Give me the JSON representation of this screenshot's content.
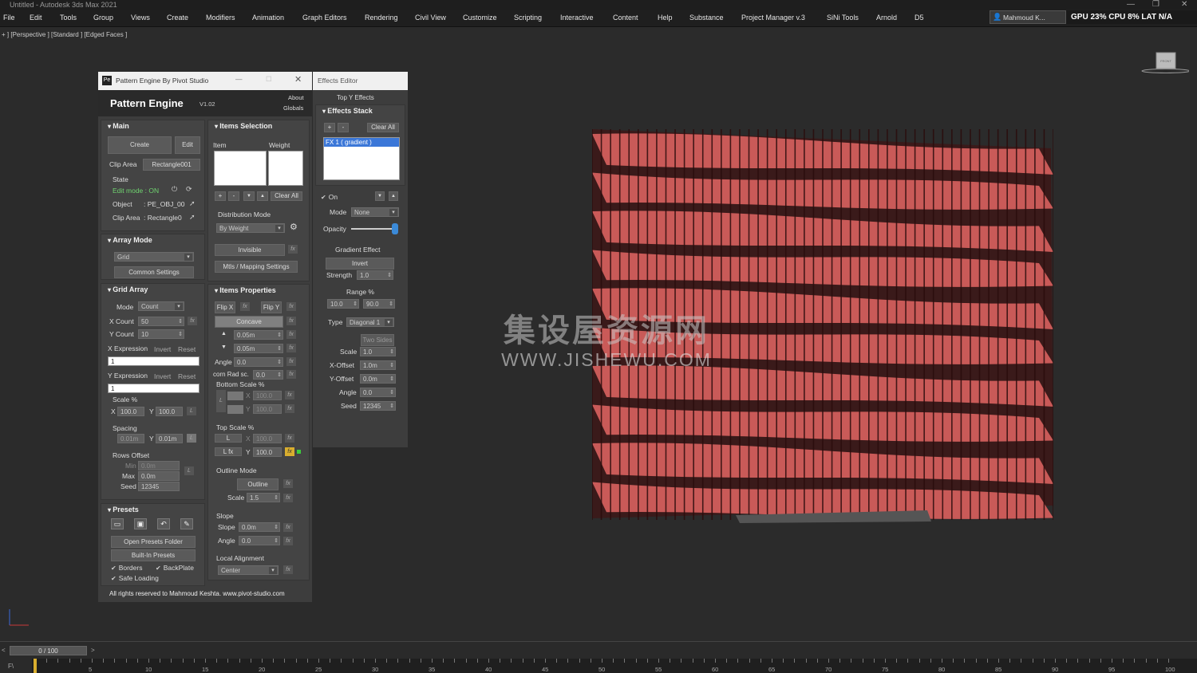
{
  "titlebar": {
    "title": "Untitled - Autodesk 3ds Max 2021",
    "controls": [
      "—",
      "❐",
      "✕"
    ]
  },
  "menu": [
    "File",
    "Edit",
    "Tools",
    "Group",
    "Views",
    "Create",
    "Modifiers",
    "Animation",
    "Graph Editors",
    "Rendering",
    "Civil View",
    "Customize",
    "Scripting",
    "Interactive",
    "Content",
    "Help",
    "Substance",
    "Project Manager v.3",
    "SiNi Tools",
    "Arnold",
    "D5"
  ],
  "user": "Mahmoud K...",
  "perf": "GPU 23% CPU 8% LAT N/A",
  "viewport_label": "+ ] [Perspective ] [Standard ] [Edged Faces ]",
  "viewcube_label": "FRONT",
  "watermark": {
    "line1": "集设屋资源网",
    "line2": "WWW.JISHEWU.COM"
  },
  "pattern_engine": {
    "window_title": "Pattern Engine By Pivot Studio",
    "window_controls": [
      "—",
      "☐",
      "✕"
    ],
    "title": "Pattern Engine",
    "version": "V1.02",
    "about": "About",
    "globals": "Globals",
    "main": {
      "header": "Main",
      "create": "Create",
      "edit": "Edit",
      "clip_area_label": "Clip Area",
      "clip_area_value": "Rectangle001",
      "state_label": "State",
      "edit_mode": "Edit mode : ON",
      "object": "Object",
      "object_value": ": PE_OBJ_00",
      "clip_area2": "Clip Area",
      "clip_area2_value": ": Rectangle0"
    },
    "array_mode": {
      "header": "Array Mode",
      "value": "Grid",
      "common": "Common Settings"
    },
    "grid_array": {
      "header": "Grid Array",
      "mode": "Mode",
      "mode_value": "Count",
      "xcount": "X Count",
      "xcount_value": "50",
      "ycount": "Y Count",
      "ycount_value": "10",
      "xexpr": "X Expression",
      "yexpr": "Y Expression",
      "invert": "Invert",
      "reset": "Reset",
      "xexpr_value": "1",
      "yexpr_value": "1",
      "scale": "Scale %",
      "x": "X",
      "y": "Y",
      "scale_x": "100.0",
      "scale_y": "100.0",
      "spacing": "Spacing",
      "spacing_x": "0.01m",
      "spacing_y": "0.01m",
      "rows_offset": "Rows Offset",
      "min": "Min",
      "max": "Max",
      "seed": "Seed",
      "min_value": "0.0m",
      "max_value": "0.0m",
      "seed_value": "12345",
      "lock": "L"
    },
    "presets": {
      "header": "Presets",
      "open": "Open Presets Folder",
      "builtin": "Built-In Presets",
      "borders": "Borders",
      "backplate": "BackPlate",
      "safe": "Safe Loading"
    },
    "items_selection": {
      "header": "Items Selection",
      "item": "Item",
      "weight": "Weight",
      "plus": "+",
      "minus": "-",
      "down": "▼",
      "up": "▲",
      "clear": "Clear All",
      "dist_label": "Distribution Mode",
      "dist_value": "By Weight",
      "invisible": "Invisible",
      "mtls": "Mtls / Mapping Settings"
    },
    "items_props": {
      "header": "Items Properties",
      "flipx": "Flip X",
      "flipy": "Flip Y",
      "concave": "Concave",
      "v1": "0.05m",
      "v2": "0.05m",
      "angle": "Angle",
      "angle_value": "0.0",
      "corn": "corn Rad sc.",
      "corn_value": "0.0",
      "bottom_scale": "Bottom Scale %",
      "bs_x": "100.0",
      "bs_y": "100.0",
      "top_scale": "Top Scale %",
      "ts_x": "100.0",
      "ts_y": "100.0",
      "lfx": "L fx",
      "outline_mode": "Outline Mode",
      "outline": "Outline",
      "oscale": "Scale",
      "oscale_value": "1.5",
      "slope_h": "Slope",
      "slope": "Slope",
      "slope_value": "0.0m",
      "sangle": "Angle",
      "sangle_value": "0.0",
      "local": "Local Alignment",
      "local_value": "Center",
      "fx": "fx",
      "lock": "L"
    },
    "footer": "All rights reserved to Mahmoud Keshta. www.pivot-studio.com"
  },
  "effects_editor": {
    "window_title": "Effects Editor",
    "tabs": "Top Y  Effects",
    "stack_header": "Effects Stack",
    "plus": "+",
    "minus": "-",
    "clear": "Clear All",
    "item": "FX 1  ( gradient )",
    "on": "On",
    "mode": "Mode",
    "mode_value": "None",
    "opacity": "Opacity",
    "gradient_effect": "Gradient Effect",
    "invert": "Invert",
    "strength": "Strength",
    "strength_value": "1.0",
    "range": "Range %",
    "range_min": "10.0",
    "range_max": "90.0",
    "type": "Type",
    "type_value": "Diagonal 1",
    "two_sides": "Two Sides",
    "scale": "Scale",
    "scale_value": "1.0",
    "xoff": "X-Offset",
    "xoff_value": "1.0m",
    "yoff": "Y-Offset",
    "yoff_value": "0.0m",
    "angle": "Angle",
    "angle_value": "0.0",
    "seed": "Seed",
    "seed_value": "12345",
    "opacity_level": 1.0
  },
  "timeline": {
    "slider": "0 / 100",
    "prev": "<",
    "next": ">",
    "ticks": [
      "5",
      "10",
      "15",
      "20",
      "25",
      "30",
      "35",
      "40",
      "45",
      "50",
      "55",
      "60",
      "65",
      "70",
      "75",
      "80",
      "85",
      "90",
      "95",
      "100"
    ],
    "corner": "F\\"
  },
  "colors": {
    "wall": "#c95a58",
    "gap": "#3a1a1a",
    "accent": "#d9ae2e",
    "selected": "#3b77d8",
    "editmode": "#6fd36f"
  }
}
